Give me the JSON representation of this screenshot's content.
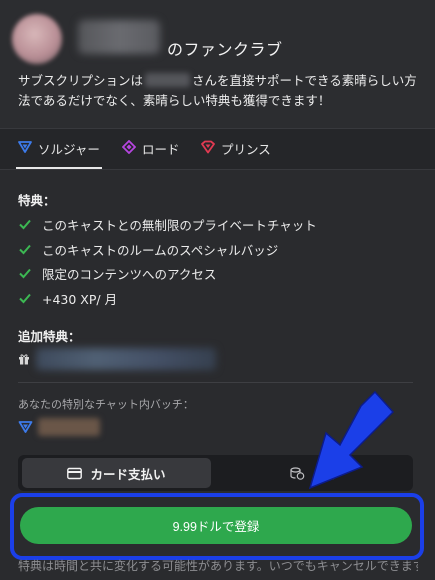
{
  "header": {
    "club_title": "のファンクラブ",
    "description_before": "サブスクリプションは",
    "description_after": "さんを直接サポートできる素晴らしい方法であるだけでなく、素晴らしい特典も獲得できます！"
  },
  "tabs": [
    {
      "label": "ソルジャー",
      "color": "#3d7bea",
      "active": true
    },
    {
      "label": "ロード",
      "color": "#b645e0",
      "active": false
    },
    {
      "label": "プリンス",
      "color": "#e23a52",
      "active": false
    }
  ],
  "perks": {
    "title": "特典：",
    "items": [
      "このキャストとの無制限のプライベートチャット",
      "このキャストのルームのスペシャルバッジ",
      "限定のコンテンツへのアクセス",
      "+430 XP/ 月"
    ]
  },
  "additional": {
    "title": "追加特典："
  },
  "badge": {
    "label": "あなたの特別なチャット内バッチ："
  },
  "payment": {
    "card_label": "カード支払い",
    "coin_label": "コイ"
  },
  "subscribe": {
    "label": "9.99ドルで登録"
  },
  "footnote": "特典は時間と共に変化する可能性があります。いつでもキャンセルできます。",
  "colors": {
    "accent_green": "#2ea84d",
    "annotation_blue": "#1b3fe8",
    "check_green": "#3cb853"
  }
}
